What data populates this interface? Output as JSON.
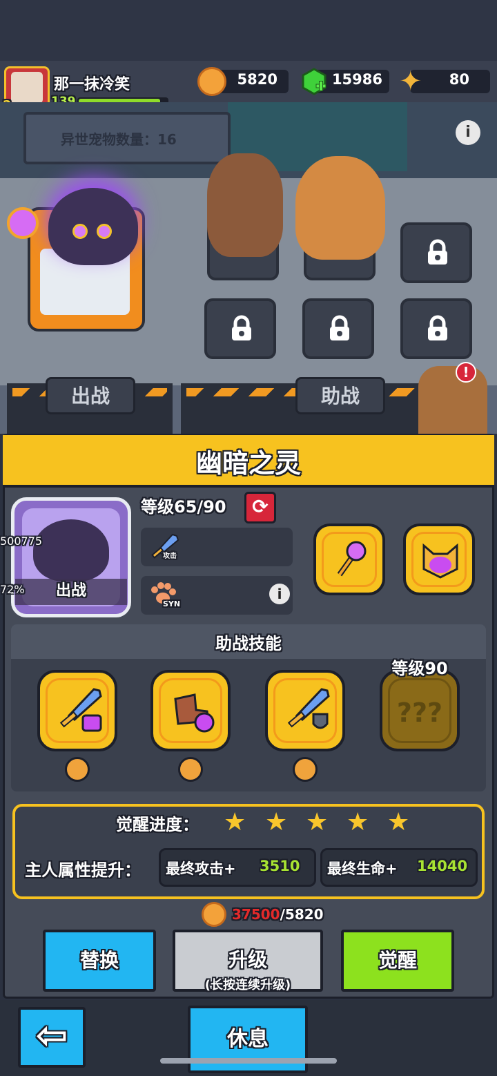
{
  "player": {
    "name": "那一抹冷笑",
    "level": "2",
    "exp": "139",
    "exp_fraction": 0.92
  },
  "currency": {
    "coins": "5820",
    "gems": "15986",
    "stars": "80"
  },
  "scene": {
    "board_text": "异世宠物数量：16",
    "battle_label": "出战",
    "assist_label": "助战",
    "alert": "!"
  },
  "pet": {
    "name": "幽暗之灵",
    "status": "出战",
    "level_text": "等级65/90",
    "attack": "500775",
    "attack_tag": "攻击",
    "syn_value": "72%",
    "syn_tag": "SYN"
  },
  "skills": {
    "title": "助战技能",
    "locked_text": "???",
    "locked_level": "等级90",
    "items": [
      {
        "icon": "sword-skull-icon"
      },
      {
        "icon": "boots-icon"
      },
      {
        "icon": "sword-shield-icon"
      }
    ]
  },
  "awaken": {
    "label": "觉醒进度：",
    "stars": 5,
    "owner_label": "主人属性提升：",
    "atk_label": "最终攻击+",
    "atk_value": "3510",
    "hp_label": "最终生命+",
    "hp_value": "14040"
  },
  "cost": {
    "required": "37500",
    "owned": "/5820"
  },
  "buttons": {
    "replace": "替换",
    "upgrade": "升级",
    "upgrade_sub": "(长按连续升级)",
    "awaken": "觉醒",
    "rest": "休息",
    "back": "⇦"
  },
  "colors": {
    "accent_yellow": "#f7c21f",
    "blue_button": "#22b6f2",
    "green_button": "#8de11e",
    "cost_red": "#e32a2a",
    "bonus_green": "#a8e332"
  }
}
